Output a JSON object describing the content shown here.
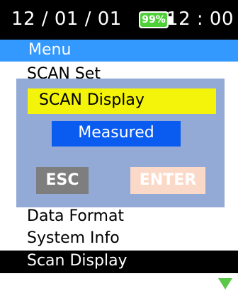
{
  "status": {
    "date": "12 / 01 / 01",
    "battery_percent": "99%",
    "battery_level": 0.99,
    "time": "12 : 00"
  },
  "menu": {
    "title": "Menu",
    "items": [
      {
        "label": "SCAN Set"
      },
      {
        "label": "Data Format"
      },
      {
        "label": "System Info"
      },
      {
        "label": "Scan Display"
      }
    ],
    "selected": "Scan Display"
  },
  "dialog": {
    "title": "SCAN Display",
    "value": "Measured",
    "esc_label": "ESC",
    "enter_label": "ENTER"
  },
  "colors": {
    "menubar": "#3399ff",
    "dialog_bg": "#93a9d6",
    "dialog_title_bg": "#f4f40a",
    "value_bg": "#0a5cf0",
    "battery": "#4fd03a",
    "scroll_arrow": "#5cc84a"
  },
  "icons": {
    "battery": "battery-icon",
    "scroll": "scroll-down-arrow-icon"
  }
}
